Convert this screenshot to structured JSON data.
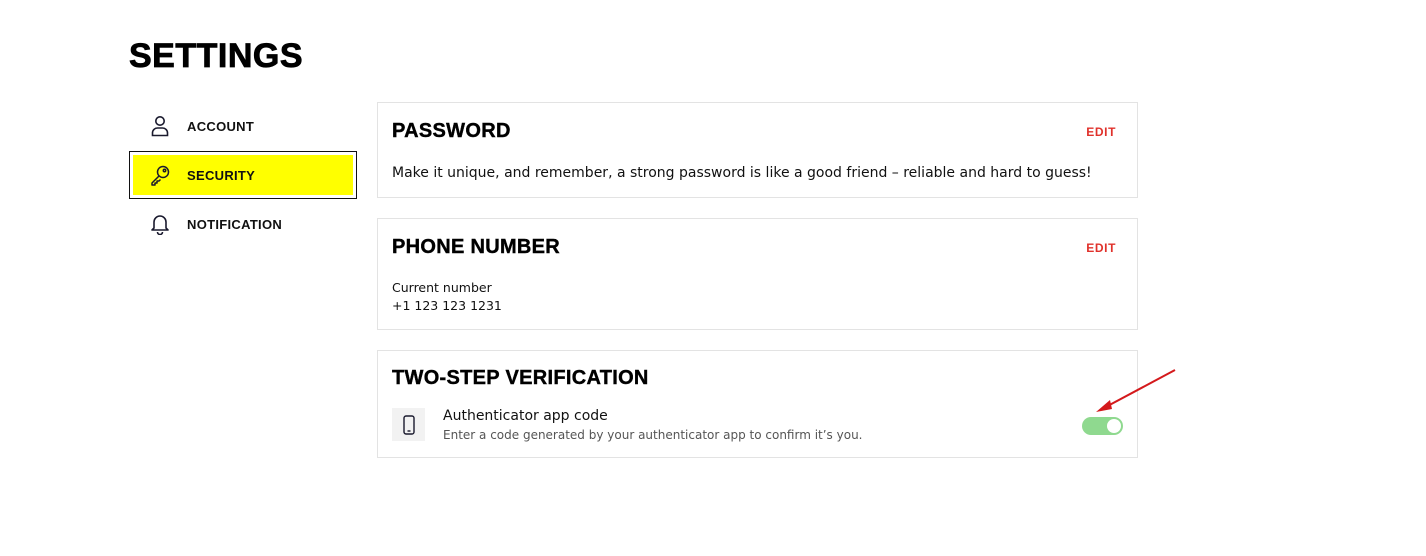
{
  "page": {
    "title": "SETTINGS"
  },
  "sidebar": {
    "items": [
      {
        "label": "ACCOUNT",
        "icon": "user-icon",
        "active": false
      },
      {
        "label": "SECURITY",
        "icon": "key-icon",
        "active": true
      },
      {
        "label": "NOTIFICATION",
        "icon": "bell-icon",
        "active": false
      }
    ]
  },
  "password": {
    "title": "PASSWORD",
    "edit_label": "EDIT",
    "description": "Make it unique, and remember, a strong password is like a good friend – reliable and hard to guess!"
  },
  "phone": {
    "title": "PHONE NUMBER",
    "edit_label": "EDIT",
    "current_label": "Current number",
    "number": "+1 123 123 1231"
  },
  "two_step": {
    "title": "TWO-STEP VERIFICATION",
    "method_title": "Authenticator app code",
    "method_description": "Enter a code generated by your authenticator app to confirm it’s you.",
    "icon": "smartphone-icon",
    "enabled": true
  },
  "colors": {
    "accent_yellow": "#ffff00",
    "edit_red": "#e0312b",
    "toggle_on": "#8fd98f",
    "annotation_arrow": "#d4191c"
  }
}
